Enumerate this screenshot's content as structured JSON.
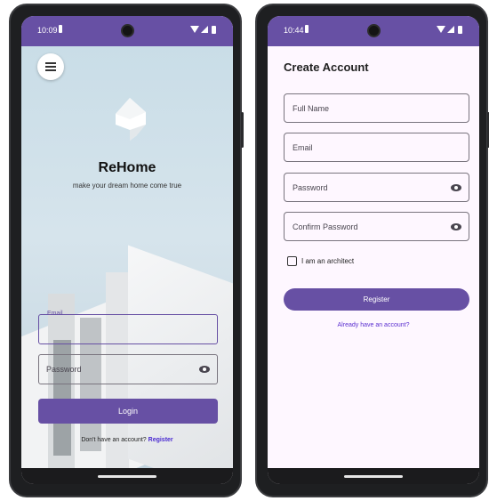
{
  "login_screen": {
    "status_bar": {
      "time": "10:09"
    },
    "menu_icon": "hamburger-menu-icon",
    "logo_icon": "house-logo-icon",
    "brand": "ReHome",
    "tagline": "make your dream home come true",
    "email_field": {
      "label": "Email",
      "value": ""
    },
    "password_field": {
      "placeholder": "Password",
      "icon": "eye-icon"
    },
    "login_button": "Login",
    "register_prompt": "Don't have an account?",
    "register_link": "Register"
  },
  "create_account_screen": {
    "status_bar": {
      "time": "10:44"
    },
    "title": "Create Account",
    "fields": [
      {
        "placeholder": "Full Name"
      },
      {
        "placeholder": "Email"
      },
      {
        "placeholder": "Password",
        "icon": "eye-icon"
      },
      {
        "placeholder": "Confirm Password",
        "icon": "eye-icon"
      }
    ],
    "architect_checkbox": {
      "label": "I am an architect",
      "checked": false
    },
    "register_button": "Register",
    "login_link": "Already have an account?"
  },
  "colors": {
    "primary": "#6750a4",
    "surface": "#fef7ff",
    "link": "#5b2fd0"
  }
}
